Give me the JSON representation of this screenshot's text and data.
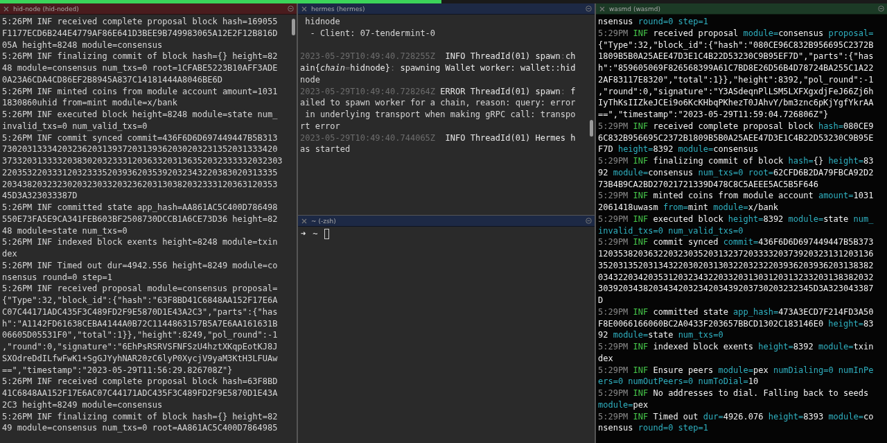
{
  "columns": [
    {
      "panes": [
        {
          "title": "hid-node (hid-noded)",
          "color": "#4a1c1e",
          "kind": "plain",
          "lines": [
            "5:26PM INF received complete proposal block hash=169055",
            "F1177ECD6B244E4779AF86E641D3BEE9B749983065A12E2F12B816D",
            "05A height=8248 module=consensus",
            "5:26PM INF finalizing commit of block hash={} height=82",
            "48 module=consensus num_txs=0 root=1CFABE5223B10AFF3ADE",
            "0A23A6CDA4CD86EF2B8945A837C14181444A8046BE6D",
            "5:26PM INF minted coins from module account amount=1031",
            "1830860uhid from=mint module=x/bank",
            "5:26PM INF executed block height=8248 module=state num_",
            "invalid_txs=0 num_valid_txs=0",
            "5:26PM INF commit synced commit=436F6D6D697449447B5B313",
            "7302031333420323620313937203139362030203231352031333420",
            "37332031333320383020323331203633203136352032333332032303",
            "2203532203331203233352039362035392032343220383020313335",
            "2034382032323020323033203236203130382032333120363120353",
            "45D3A323033387D",
            "5:26PM INF committed state app_hash=AA861AC5C400D786498",
            "550E73FA5E9CA341FEB603BF2508730DCCB1A6CE73D36 height=82",
            "48 module=state num_txs=0",
            "5:26PM INF indexed block exents height=8248 module=txin",
            "dex",
            "5:26PM INF Timed out dur=4942.556 height=8249 module=co",
            "nsensus round=0 step=1",
            "5:26PM INF received proposal module=consensus proposal=",
            "{\"Type\":32,\"block_id\":{\"hash\":\"63F8BD41C6848AA152F17E6A",
            "C07C44171ADC435F3C489FD2F9E5870D1E43A2C3\",\"parts\":{\"has",
            "h\":\"A1142FD61638CEBA4144A0B72C1144863157B5A7E6AA161631B",
            "06605D05531F0\",\"total\":1}},\"height\":8249,\"pol_round\":-1",
            ",\"round\":0,\"signature\":\"6EhPsRSRVSFNFSzU4hztXKqpEotKJ8J",
            "SXOdreDdILfwFwK1+SgGJYyhNAR20zC6lyP0XycjV9yaM3KtH3LFUAw",
            "==\",\"timestamp\":\"2023-05-29T11:56:29.826708Z\"}",
            "5:26PM INF received complete proposal block hash=63F8BD",
            "41C6848AA152F17E6AC07C44171ADC435F3C489FD2F9E5870D1E43A",
            "2C3 height=8249 module=consensus",
            "5:26PM INF finalizing commit of block hash={} height=82",
            "49 module=consensus num_txs=0 root=AA861AC5C400D7864985"
          ]
        }
      ]
    },
    {
      "panes": [
        {
          "title": "hermes (hermes)",
          "color": "#1d2945",
          "kind": "plain",
          "lines": [
            " hidnode",
            "  - Client: 07-tendermint-0",
            {
              "space_before": true,
              "segments": [
                {
                  "kind": "dim",
                  "text": "2023-05-29T10:49:40.728255Z"
                },
                {
                  "kind": "text",
                  "text": "  INFO ThreadId(01) spawn"
                },
                {
                  "kind": "dim",
                  "text": ":"
                },
                {
                  "kind": "text",
                  "text": "ch"
                }
              ]
            },
            {
              "segments": [
                {
                  "kind": "text",
                  "text": "ain{"
                },
                {
                  "kind": "italic",
                  "text": "chain"
                },
                {
                  "kind": "dim",
                  "text": "="
                },
                {
                  "kind": "text",
                  "text": "hidnode}"
                },
                {
                  "kind": "dim",
                  "text": ":"
                },
                {
                  "kind": "text",
                  "text": " spawning Wallet worker: wallet::hid"
                }
              ]
            },
            "node",
            {
              "segments": [
                {
                  "kind": "dim",
                  "text": "2023-05-29T10:49:40.728264Z"
                },
                {
                  "kind": "text",
                  "text": " ERROR ThreadId(01) spawn"
                },
                {
                  "kind": "dim",
                  "text": ":"
                },
                {
                  "kind": "text",
                  "text": " f"
                }
              ]
            },
            "ailed to spawn worker for a chain, reason: query: error",
            " in underlying transport when making gRPC call: transpo",
            "rt error",
            {
              "segments": [
                {
                  "kind": "dim",
                  "text": "2023-05-29T10:49:40.744065Z"
                },
                {
                  "kind": "text",
                  "text": "  INFO ThreadId(01) Hermes h"
                }
              ]
            },
            "as started"
          ]
        },
        {
          "title": "~ (-zsh)",
          "color": "#1d2945",
          "kind": "plain",
          "prompt": {
            "symbol": "➜",
            "path": "~"
          }
        }
      ]
    },
    {
      "panes": [
        {
          "title": "wasmd (wasmd)",
          "color": "#1c3a26",
          "kind": "colored",
          "lines": [
            {
              "segments": [
                {
                  "kind": "text",
                  "text": "nsensus "
                },
                {
                  "kind": "key",
                  "text": "round=0 "
                },
                {
                  "kind": "key",
                  "text": "step=1"
                }
              ]
            },
            {
              "segments": [
                {
                  "kind": "dim",
                  "text": "5:29PM "
                },
                {
                  "kind": "level",
                  "text": "INF"
                },
                {
                  "kind": "text",
                  "text": " received proposal "
                },
                {
                  "kind": "key",
                  "text": "module="
                },
                {
                  "kind": "text",
                  "text": "consensus "
                },
                {
                  "kind": "key",
                  "text": "proposal="
                }
              ]
            },
            "{\"Type\":32,\"block_id\":{\"hash\":\"080CE96C832B956695C2372B",
            "1809B5B0A25AEE47D3E1C4B22D53230C9B95EF7D\",\"parts\":{\"has",
            "h\":\"859605069F826568399A61C7BD8E26D56B4D78724BA255C1A22",
            "2AF83117E8320\",\"total\":1}},\"height\":8392,\"pol_round\":-1",
            ",\"round\":0,\"signature\":\"Y3ASdeqnPlLSM5LXFXgxdjFeJ66Zj6h",
            "IyThKsIIZkeJCEi9o6KcKHbqPKhezT0JAhvY/bm3znc6pKjYgfYkrAA",
            "==\",\"timestamp\":\"2023-05-29T11:59:04.726806Z\"}",
            {
              "segments": [
                {
                  "kind": "dim",
                  "text": "5:29PM "
                },
                {
                  "kind": "level",
                  "text": "INF"
                },
                {
                  "kind": "text",
                  "text": " received complete proposal block "
                },
                {
                  "kind": "key",
                  "text": "hash="
                },
                {
                  "kind": "text",
                  "text": "080CE9"
                }
              ]
            },
            "6C832B956695C2372B1809B5B0A25AEE47D3E1C4B22D53230C9B95E",
            {
              "segments": [
                {
                  "kind": "text",
                  "text": "F7D "
                },
                {
                  "kind": "key",
                  "text": "height="
                },
                {
                  "kind": "text",
                  "text": "8392 "
                },
                {
                  "kind": "key",
                  "text": "module="
                },
                {
                  "kind": "text",
                  "text": "consensus"
                }
              ]
            },
            {
              "segments": [
                {
                  "kind": "dim",
                  "text": "5:29PM "
                },
                {
                  "kind": "level",
                  "text": "INF"
                },
                {
                  "kind": "text",
                  "text": " finalizing commit of block "
                },
                {
                  "kind": "key",
                  "text": "hash="
                },
                {
                  "kind": "text",
                  "text": "{} "
                },
                {
                  "kind": "key",
                  "text": "height="
                },
                {
                  "kind": "text",
                  "text": "83"
                }
              ]
            },
            {
              "segments": [
                {
                  "kind": "text",
                  "text": "92 "
                },
                {
                  "kind": "key",
                  "text": "module="
                },
                {
                  "kind": "text",
                  "text": "consensus "
                },
                {
                  "kind": "key",
                  "text": "num_txs=0 "
                },
                {
                  "kind": "key",
                  "text": "root="
                },
                {
                  "kind": "text",
                  "text": "62CFD6B2DA79FBCA92D2"
                }
              ]
            },
            "73B4B9CA2BD27021721339D478C8C5AEEE5AC5B5F646",
            {
              "segments": [
                {
                  "kind": "dim",
                  "text": "5:29PM "
                },
                {
                  "kind": "level",
                  "text": "INF"
                },
                {
                  "kind": "text",
                  "text": " minted coins from module account "
                },
                {
                  "kind": "key",
                  "text": "amount="
                },
                {
                  "kind": "text",
                  "text": "1031"
                }
              ]
            },
            {
              "segments": [
                {
                  "kind": "text",
                  "text": "2061418uwasm "
                },
                {
                  "kind": "key",
                  "text": "from="
                },
                {
                  "kind": "text",
                  "text": "mint "
                },
                {
                  "kind": "key",
                  "text": "module="
                },
                {
                  "kind": "text",
                  "text": "x/bank"
                }
              ]
            },
            {
              "segments": [
                {
                  "kind": "dim",
                  "text": "5:29PM "
                },
                {
                  "kind": "level",
                  "text": "INF"
                },
                {
                  "kind": "text",
                  "text": " executed block "
                },
                {
                  "kind": "key",
                  "text": "height="
                },
                {
                  "kind": "text",
                  "text": "8392 "
                },
                {
                  "kind": "key",
                  "text": "module="
                },
                {
                  "kind": "text",
                  "text": "state "
                },
                {
                  "kind": "key",
                  "text": "num_"
                }
              ]
            },
            {
              "segments": [
                {
                  "kind": "key",
                  "text": "invalid_txs=0 "
                },
                {
                  "kind": "key",
                  "text": "num_valid_txs=0"
                }
              ]
            },
            {
              "segments": [
                {
                  "kind": "dim",
                  "text": "5:29PM "
                },
                {
                  "kind": "level",
                  "text": "INF"
                },
                {
                  "kind": "text",
                  "text": " commit synced "
                },
                {
                  "kind": "key",
                  "text": "commit="
                },
                {
                  "kind": "text",
                  "text": "436F6D6D697449447B5B373"
                }
              ]
            },
            "1203538203632203230352031323720333320373920323131203136",
            "3520313520313432203020313032203232203936203936203138382",
            "0343220342035312032343220332031303120313233203138382032",
            "3039203438203434203234203439203730203232345D3A323043387",
            "D",
            {
              "segments": [
                {
                  "kind": "dim",
                  "text": "5:29PM "
                },
                {
                  "kind": "level",
                  "text": "INF"
                },
                {
                  "kind": "text",
                  "text": " committed state "
                },
                {
                  "kind": "key",
                  "text": "app_hash="
                },
                {
                  "kind": "text",
                  "text": "473A3ECD7F214FD3A50"
                }
              ]
            },
            {
              "segments": [
                {
                  "kind": "text",
                  "text": "F8E0066166060BC2A0433F203657BBCD1302C183146E0 "
                },
                {
                  "kind": "key",
                  "text": "height="
                },
                {
                  "kind": "text",
                  "text": "83"
                }
              ]
            },
            {
              "segments": [
                {
                  "kind": "text",
                  "text": "92 "
                },
                {
                  "kind": "key",
                  "text": "module="
                },
                {
                  "kind": "text",
                  "text": "state "
                },
                {
                  "kind": "key",
                  "text": "num_txs=0"
                }
              ]
            },
            {
              "segments": [
                {
                  "kind": "dim",
                  "text": "5:29PM "
                },
                {
                  "kind": "level",
                  "text": "INF"
                },
                {
                  "kind": "text",
                  "text": " indexed block exents "
                },
                {
                  "kind": "key",
                  "text": "height="
                },
                {
                  "kind": "text",
                  "text": "8392 "
                },
                {
                  "kind": "key",
                  "text": "module="
                },
                {
                  "kind": "text",
                  "text": "txin"
                }
              ]
            },
            "dex",
            {
              "segments": [
                {
                  "kind": "dim",
                  "text": "5:29PM "
                },
                {
                  "kind": "level",
                  "text": "INF"
                },
                {
                  "kind": "text",
                  "text": " Ensure peers "
                },
                {
                  "kind": "key",
                  "text": "module="
                },
                {
                  "kind": "text",
                  "text": "pex "
                },
                {
                  "kind": "key",
                  "text": "numDialing=0 "
                },
                {
                  "kind": "key",
                  "text": "numInPe"
                }
              ]
            },
            {
              "segments": [
                {
                  "kind": "key",
                  "text": "ers=0 "
                },
                {
                  "kind": "key",
                  "text": "numOutPeers=0 "
                },
                {
                  "kind": "key",
                  "text": "numToDial="
                },
                {
                  "kind": "text",
                  "text": "10"
                }
              ]
            },
            {
              "segments": [
                {
                  "kind": "dim",
                  "text": "5:29PM "
                },
                {
                  "kind": "level",
                  "text": "INF"
                },
                {
                  "kind": "text",
                  "text": " No addresses to dial. Falling back to seeds"
                }
              ]
            },
            {
              "segments": [
                {
                  "kind": "key",
                  "text": "module="
                },
                {
                  "kind": "text",
                  "text": "pex"
                }
              ]
            },
            {
              "segments": [
                {
                  "kind": "dim",
                  "text": "5:29PM "
                },
                {
                  "kind": "level",
                  "text": "INF"
                },
                {
                  "kind": "text",
                  "text": " Timed out "
                },
                {
                  "kind": "key",
                  "text": "dur="
                },
                {
                  "kind": "text",
                  "text": "4926.076 "
                },
                {
                  "kind": "key",
                  "text": "height="
                },
                {
                  "kind": "text",
                  "text": "8393 "
                },
                {
                  "kind": "key",
                  "text": "module="
                },
                {
                  "kind": "text",
                  "text": "co"
                }
              ]
            },
            {
              "segments": [
                {
                  "kind": "text",
                  "text": "nsensus "
                },
                {
                  "kind": "key",
                  "text": "round=0 "
                },
                {
                  "kind": "key",
                  "text": "step=1"
                }
              ]
            }
          ]
        }
      ]
    }
  ]
}
